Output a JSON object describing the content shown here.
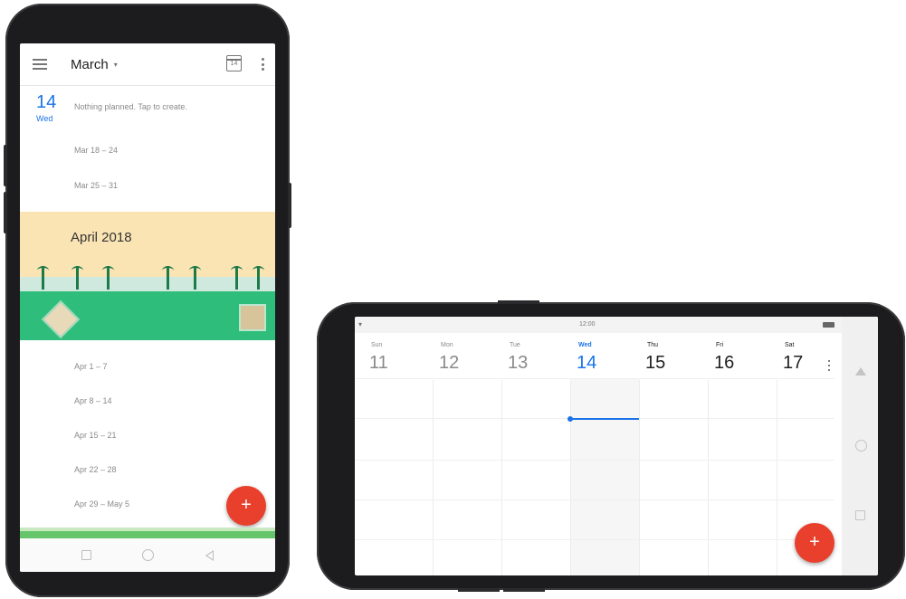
{
  "portrait": {
    "toolbar": {
      "month_label": "March",
      "caret": "▾",
      "calendar_icon_day": "14"
    },
    "today": {
      "day_number": "14",
      "day_of_week": "Wed",
      "empty_text": "Nothing planned. Tap to create."
    },
    "march_weeks": [
      "Mar 18 – 24",
      "Mar 25 – 31"
    ],
    "banner_title": "April 2018",
    "april_weeks": [
      "Apr 1 – 7",
      "Apr 8 – 14",
      "Apr 15 – 21",
      "Apr 22 – 28",
      "Apr 29 – May 5"
    ],
    "fab_label": "+"
  },
  "landscape": {
    "status_time": "12:00",
    "wifi_glyph": "▾",
    "days": [
      {
        "dow": "Sun",
        "num": "11"
      },
      {
        "dow": "Mon",
        "num": "12"
      },
      {
        "dow": "Tue",
        "num": "13"
      },
      {
        "dow": "Wed",
        "num": "14"
      },
      {
        "dow": "Thu",
        "num": "15"
      },
      {
        "dow": "Fri",
        "num": "16"
      },
      {
        "dow": "Sat",
        "num": "17"
      }
    ],
    "fab_label": "+"
  },
  "colors": {
    "accent": "#1a73e8",
    "fab": "#e8402c",
    "banner_sky": "#fbe4b4",
    "banner_grass": "#2ebd7a"
  }
}
